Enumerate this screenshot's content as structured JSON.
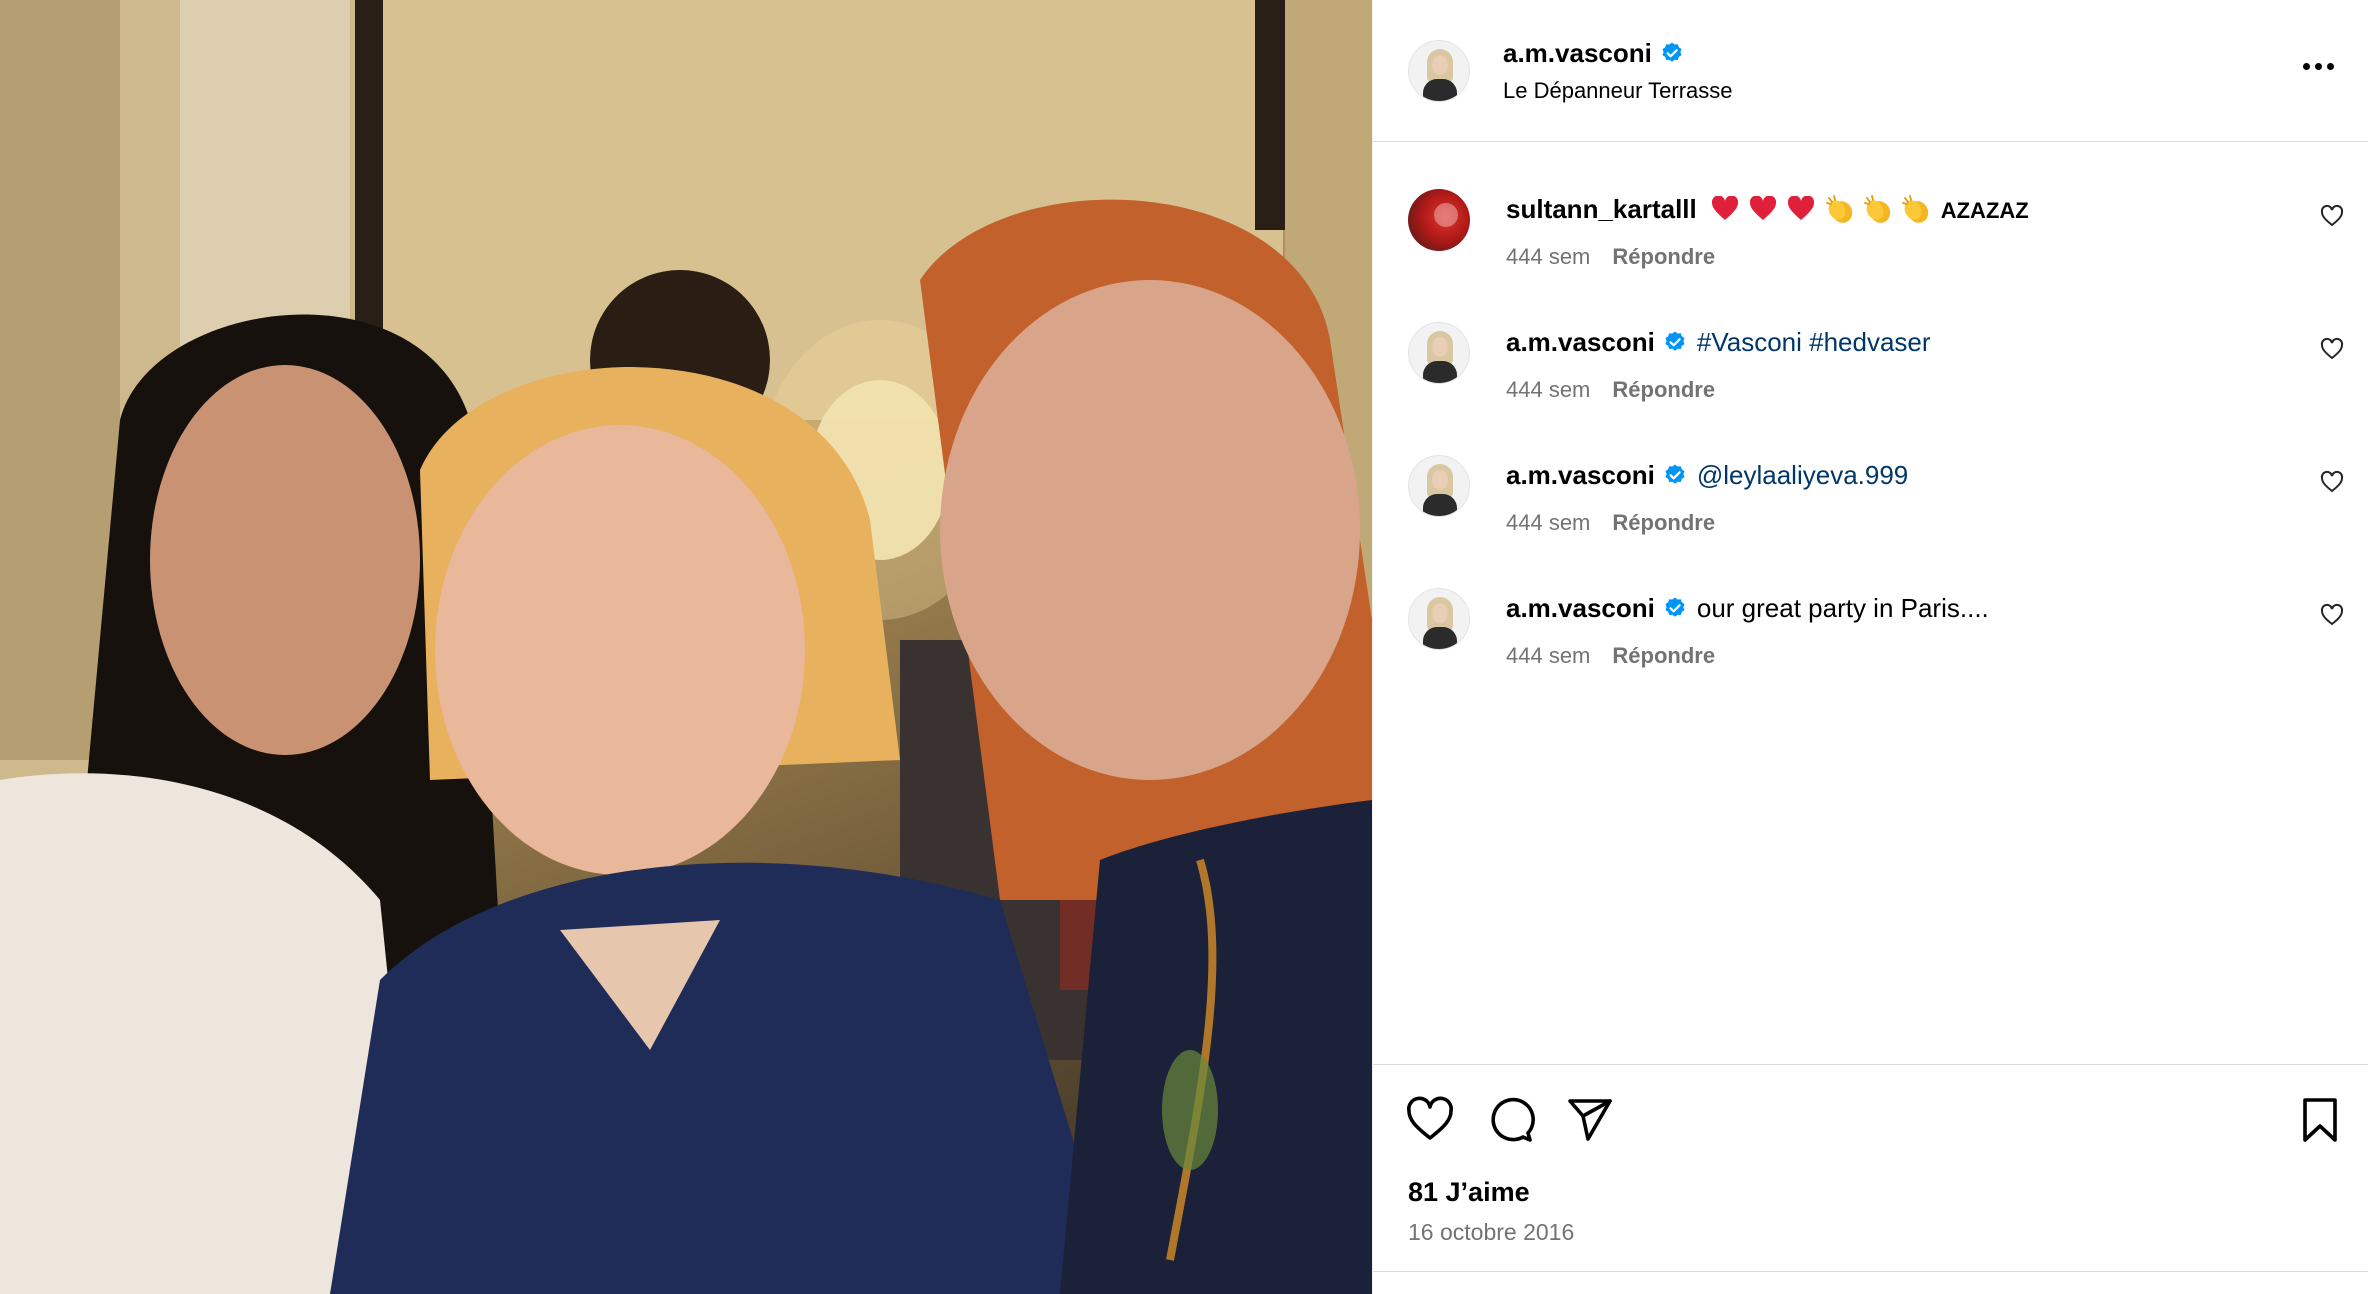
{
  "post": {
    "owner": "a.m.vasconi",
    "owner_verified": true,
    "location": "Le Dépanneur Terrasse",
    "more_icon": "ellipsis-icon"
  },
  "comments": [
    {
      "user": "sultann_kartalll",
      "verified": false,
      "avatar": "red-avatar",
      "emoji_sequence": [
        "red-heart",
        "red-heart",
        "red-heart",
        "clapping-hands",
        "clapping-hands",
        "clapping-hands"
      ],
      "text": "AZAZAZ",
      "age": "444 sem",
      "reply_label": "Répondre"
    },
    {
      "user": "a.m.vasconi",
      "verified": true,
      "avatar": "owner-avatar",
      "text": "#Vasconi #hedvaser",
      "age": "444 sem",
      "reply_label": "Répondre"
    },
    {
      "user": "a.m.vasconi",
      "verified": true,
      "avatar": "owner-avatar",
      "text": "@leylaaliyeva.999",
      "age": "444 sem",
      "reply_label": "Répondre"
    },
    {
      "user": "a.m.vasconi",
      "verified": true,
      "avatar": "owner-avatar",
      "text": "our great party in Paris....",
      "age": "444 sem",
      "reply_label": "Répondre"
    }
  ],
  "actions": {
    "icons": [
      "heart-icon",
      "comment-icon",
      "share-icon",
      "bookmark-icon"
    ],
    "likes": "81 J’aime",
    "date": "16 octobre 2016"
  },
  "colors": {
    "link": "#00376b",
    "verified": "#0095f6",
    "muted": "#737373",
    "divider": "#dbdbdb",
    "heart_emoji": "#e0203a"
  }
}
